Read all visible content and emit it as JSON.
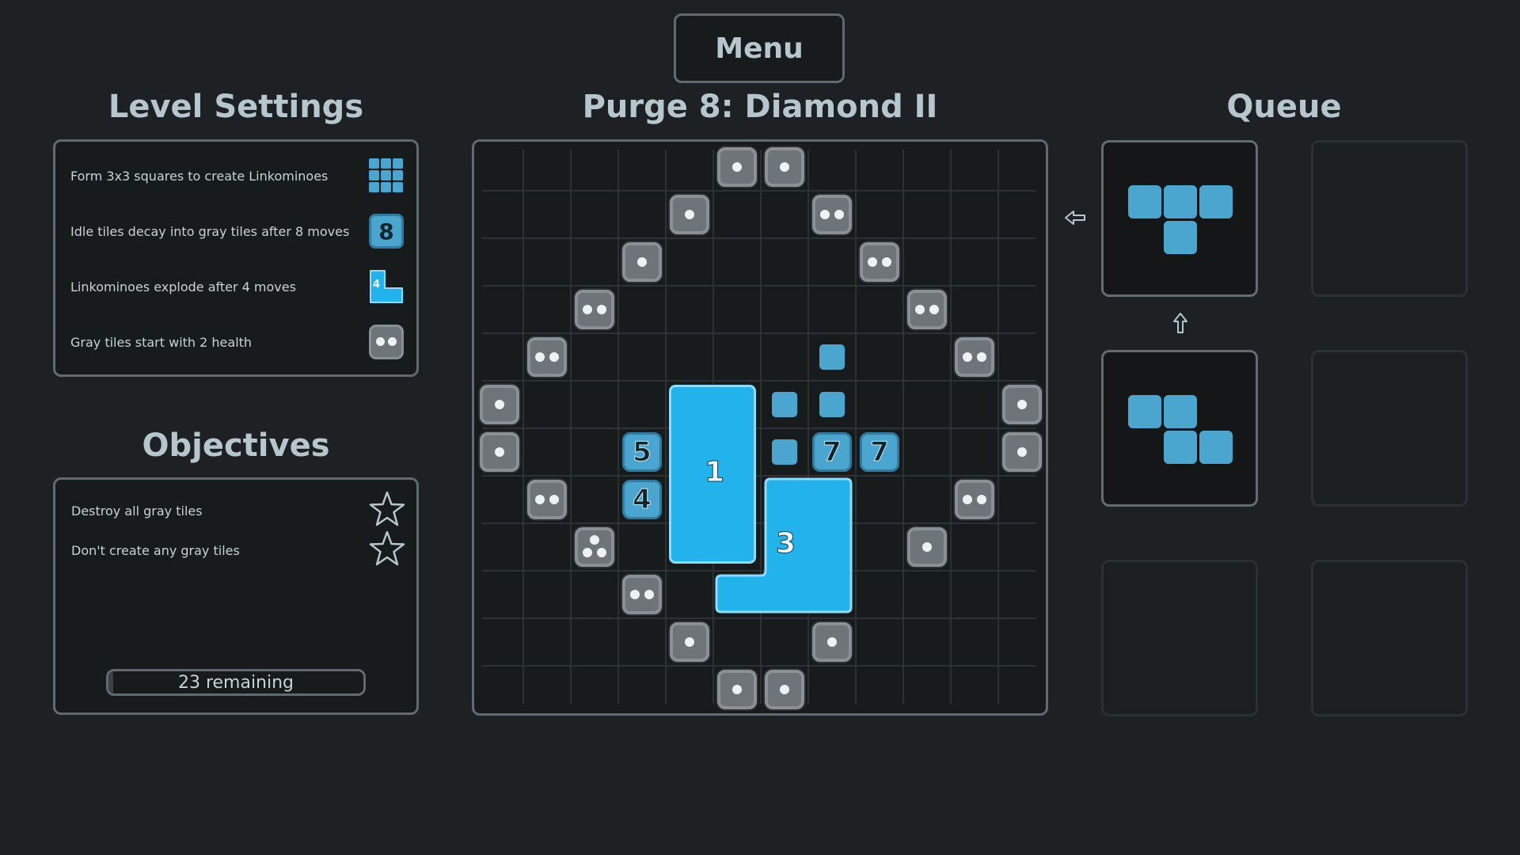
{
  "menu_label": "Menu",
  "level_title": "Purge 8: Diamond II",
  "level_settings": {
    "heading": "Level Settings",
    "rows": [
      {
        "text": "Form 3x3 squares to create Linkominoes",
        "icon": "grid-3x3-icon"
      },
      {
        "text": "Idle tiles decay into gray tiles after 8 moves",
        "icon": "decay-counter-icon",
        "badge": "8"
      },
      {
        "text": "Linkominoes explode after 4 moves",
        "icon": "linkomino-timer-icon",
        "badge": "4"
      },
      {
        "text": "Gray tiles start with 2 health",
        "icon": "gray-tile-health-icon"
      }
    ]
  },
  "objectives": {
    "heading": "Objectives",
    "items": [
      {
        "text": "Destroy all gray tiles",
        "icon": "star-outline-icon"
      },
      {
        "text": "Don't create any gray tiles",
        "icon": "star-outline-icon"
      }
    ],
    "progress_text": "23 remaining",
    "progress_fraction": 0.02
  },
  "queue": {
    "heading": "Queue"
  },
  "board": {
    "size": 12,
    "gray_tiles": [
      {
        "col": 5,
        "row": 0,
        "health": 1
      },
      {
        "col": 6,
        "row": 0,
        "health": 1
      },
      {
        "col": 4,
        "row": 1,
        "health": 1
      },
      {
        "col": 7,
        "row": 1,
        "health": 2
      },
      {
        "col": 3,
        "row": 2,
        "health": 1
      },
      {
        "col": 8,
        "row": 2,
        "health": 2
      },
      {
        "col": 2,
        "row": 3,
        "health": 2
      },
      {
        "col": 9,
        "row": 3,
        "health": 2
      },
      {
        "col": 1,
        "row": 4,
        "health": 2
      },
      {
        "col": 10,
        "row": 4,
        "health": 2
      },
      {
        "col": 0,
        "row": 5,
        "health": 1
      },
      {
        "col": 11,
        "row": 5,
        "health": 1
      },
      {
        "col": 0,
        "row": 6,
        "health": 1
      },
      {
        "col": 11,
        "row": 6,
        "health": 1
      },
      {
        "col": 1,
        "row": 7,
        "health": 2
      },
      {
        "col": 10,
        "row": 7,
        "health": 2
      },
      {
        "col": 2,
        "row": 8,
        "health": 3
      },
      {
        "col": 9,
        "row": 8,
        "health": 1
      },
      {
        "col": 3,
        "row": 9,
        "health": 2
      },
      {
        "col": 4,
        "row": 10,
        "health": 1
      },
      {
        "col": 7,
        "row": 10,
        "health": 1
      },
      {
        "col": 5,
        "row": 11,
        "health": 1
      },
      {
        "col": 6,
        "row": 11,
        "health": 1
      }
    ],
    "small_blue": [
      {
        "col": 7,
        "row": 4
      },
      {
        "col": 6,
        "row": 5
      },
      {
        "col": 7,
        "row": 5
      },
      {
        "col": 6,
        "row": 6
      }
    ],
    "numbered_tiles": [
      {
        "col": 3,
        "row": 6,
        "value": "5"
      },
      {
        "col": 3,
        "row": 7,
        "value": "4"
      },
      {
        "col": 7,
        "row": 6,
        "value": "7"
      },
      {
        "col": 8,
        "row": 6,
        "value": "7"
      }
    ],
    "linkominoes": [
      {
        "label": "1",
        "color": "#22b2ec"
      },
      {
        "label": "3",
        "color": "#22b2ec"
      }
    ]
  },
  "colors": {
    "background": "#1e2123",
    "panel_border": "#5f6b70",
    "tile_blue": "#4aa6cf",
    "linkomino_blue": "#22b2ec",
    "gray_tile": "#6e7478"
  }
}
